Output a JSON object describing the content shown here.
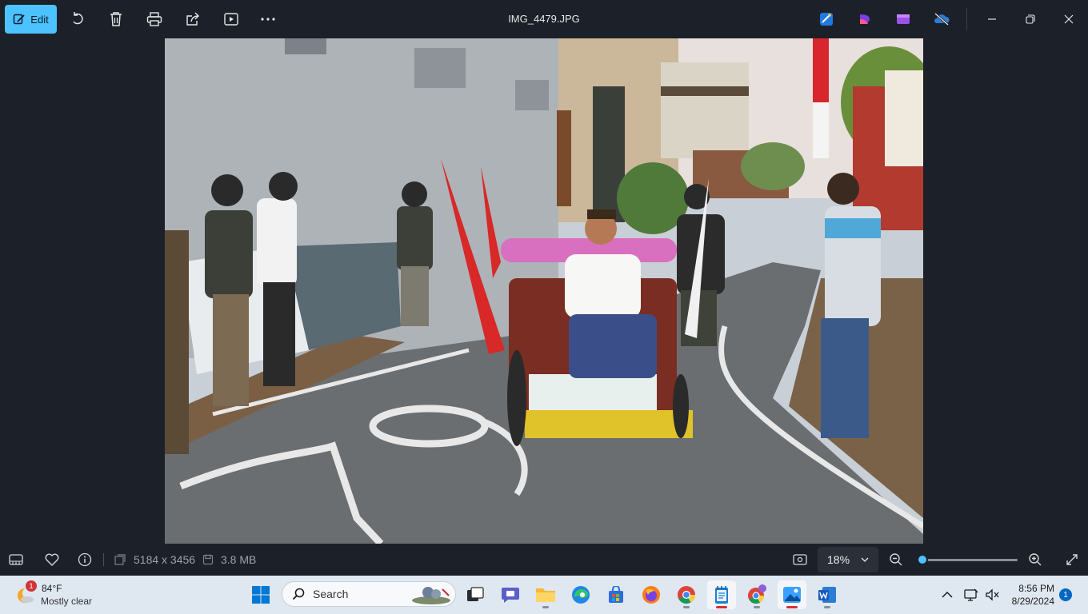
{
  "window": {
    "title": "IMG_4479.JPG",
    "edit_label": "Edit"
  },
  "toolbar_icons": [
    "rotate-icon",
    "delete-icon",
    "print-icon",
    "share-icon",
    "slideshow-icon",
    "more-icon"
  ],
  "status": {
    "dimensions": "5184 x 3456",
    "size": "3.8 MB",
    "zoom": "18%",
    "zoom_level": 0.02
  },
  "taskbar": {
    "weather_temp": "84°F",
    "weather_desc": "Mostly clear",
    "weather_badge": "1",
    "search_label": "Search",
    "time": "8:56 PM",
    "date": "8/29/2024",
    "notifications": "1"
  },
  "colors": {
    "accent": "#4cc2ff",
    "background": "#1c2028",
    "taskbar": "#dfe7f1"
  }
}
